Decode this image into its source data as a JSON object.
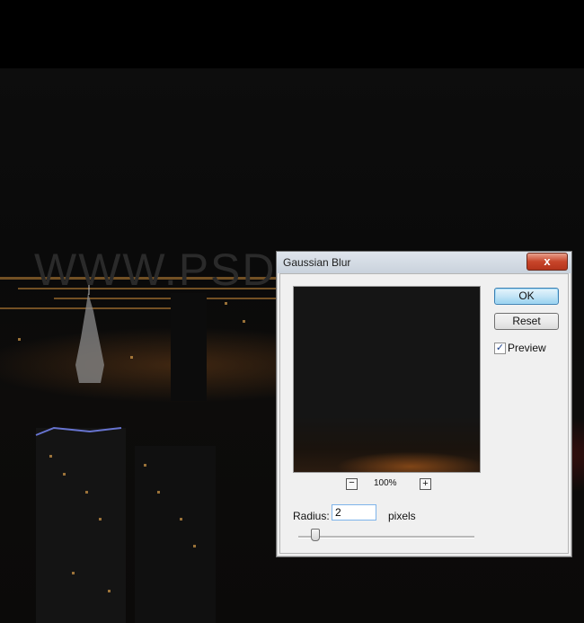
{
  "watermark": "WWW.PSD-DUDE.COM",
  "dialog": {
    "title": "Gaussian Blur",
    "close_glyph": "x",
    "ok_label": "OK",
    "reset_label": "Reset",
    "preview_checked": true,
    "preview_label": "Preview",
    "zoom_out_label": "−",
    "zoom_level": "100%",
    "zoom_in_label": "+",
    "radius_label": "Radius:",
    "radius_value": "2",
    "radius_units": "pixels"
  },
  "icons": {
    "close": "close-icon",
    "checkbox": "checkmark-icon"
  },
  "colors": {
    "accent_ok": "#98d1ef",
    "close_button": "#c7452a"
  }
}
